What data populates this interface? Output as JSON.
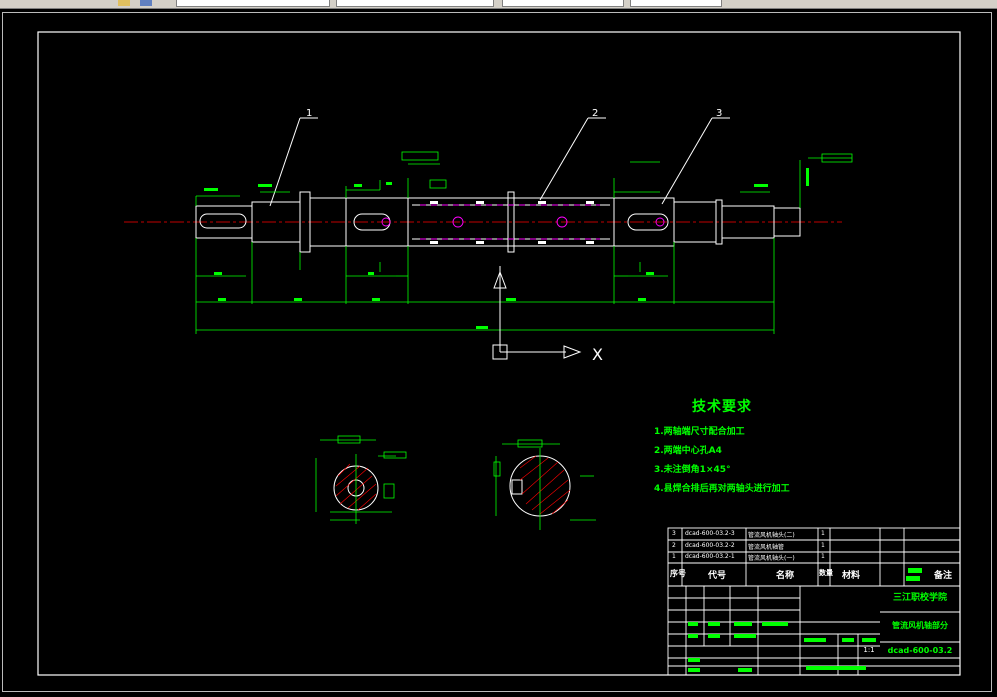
{
  "technical_requirements": {
    "title": "技术要求",
    "items": [
      "1.两轴端尺寸配合加工",
      "2.两端中心孔A4",
      "3.未注倒角1×45°",
      "4.县焊合排后再对两轴头进行加工"
    ]
  },
  "title_block": {
    "school": "三江职校学院",
    "drawing_name": "管流风机轴部分",
    "drawing_code": "dcad-600-03.2",
    "scale": "1:1",
    "header": {
      "seq": "序号",
      "code": "代号",
      "name": "名称",
      "qty": "数量",
      "material": "材料",
      "remarks": "备注"
    },
    "parts": [
      {
        "seq": "3",
        "code": "dcad-600-03.2-3",
        "name": "管流风机轴头(二)",
        "qty": "1"
      },
      {
        "seq": "2",
        "code": "dcad-600-03.2-2",
        "name": "管流风机轴管",
        "qty": "1"
      },
      {
        "seq": "1",
        "code": "dcad-600-03.2-1",
        "name": "管流风机轴头(一)",
        "qty": "1"
      }
    ]
  },
  "balloons": [
    "1",
    "2",
    "3"
  ],
  "ucs": {
    "axis": "X"
  },
  "colors": {
    "background": "#000000",
    "frame": "#ffffff",
    "part": "#ffffff",
    "dimension": "#00ff00",
    "centerline": "#ff0000",
    "hidden": "#ff00ff",
    "text": "#00ff00"
  }
}
